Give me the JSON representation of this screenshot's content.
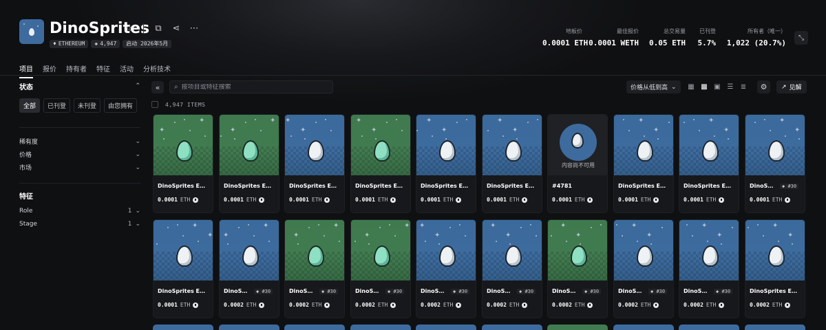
{
  "collection": {
    "title": "DinoSprites",
    "chain": "ETHEREUM",
    "supply": "4,947",
    "launched": "启动 2026年5月"
  },
  "stats": [
    {
      "label": "地板价",
      "value": "0.0001 ETH"
    },
    {
      "label": "最佳报价",
      "value": "0.0001 WETH"
    },
    {
      "label": "总交易量",
      "value": "0.05 ETH"
    },
    {
      "label": "已刊登",
      "value": "5.7%"
    },
    {
      "label": "所有者（唯一）",
      "value": "1,022 (20.7%)"
    }
  ],
  "tabs": [
    "项目",
    "报价",
    "持有者",
    "特征",
    "活动",
    "分析技术"
  ],
  "sidebar": {
    "status_title": "状态",
    "status_chips": [
      "全部",
      "已刊登",
      "未刊登",
      "由您拥有"
    ],
    "filters": [
      "稀有度",
      "价格",
      "市场"
    ],
    "traits_title": "特征",
    "traits": [
      {
        "name": "Role",
        "count": "1"
      },
      {
        "name": "Stage",
        "count": "1"
      }
    ]
  },
  "toolbar": {
    "search_placeholder": "按项目或特征搜索",
    "sort_label": "价格从低到高",
    "insight_label": "见解",
    "items_count": "4,947 ITEMS"
  },
  "colors": {
    "blue_bg": "#3d6b9e",
    "green_bg": "#417b50",
    "page_bg": "#0f1012"
  },
  "cards": [
    {
      "bg": "green",
      "name": "DinoSprites Egg ...",
      "rank": "",
      "price": "0.0001",
      "currency": "ETH",
      "unavailable": false
    },
    {
      "bg": "green",
      "name": "DinoSprites Egg ...",
      "rank": "",
      "price": "0.0001",
      "currency": "ETH",
      "unavailable": false
    },
    {
      "bg": "blue",
      "name": "DinoSprites Egg ...",
      "rank": "",
      "price": "0.0001",
      "currency": "ETH",
      "unavailable": false
    },
    {
      "bg": "green",
      "name": "DinoSprites Egg ...",
      "rank": "",
      "price": "0.0001",
      "currency": "ETH",
      "unavailable": false
    },
    {
      "bg": "blue",
      "name": "DinoSprites Egg ...",
      "rank": "",
      "price": "0.0001",
      "currency": "ETH",
      "unavailable": false
    },
    {
      "bg": "blue",
      "name": "DinoSprites Egg ...",
      "rank": "",
      "price": "0.0001",
      "currency": "ETH",
      "unavailable": false
    },
    {
      "bg": "blue",
      "name": "#4781",
      "rank": "",
      "price": "0.0001",
      "currency": "ETH",
      "unavailable": true,
      "unavailable_text": "内容尚不可用"
    },
    {
      "bg": "blue",
      "name": "DinoSprites Egg ...",
      "rank": "",
      "price": "0.0001",
      "currency": "ETH",
      "unavailable": false
    },
    {
      "bg": "blue",
      "name": "DinoSprites Egg ...",
      "rank": "",
      "price": "0.0001",
      "currency": "ETH",
      "unavailable": false
    },
    {
      "bg": "blue",
      "name": "DinoSpri...",
      "rank": "#30",
      "price": "0.0001",
      "currency": "ETH",
      "unavailable": false
    },
    {
      "bg": "blue",
      "name": "DinoSprites Egg ...",
      "rank": "",
      "price": "0.0001",
      "currency": "ETH",
      "unavailable": false
    },
    {
      "bg": "blue",
      "name": "DinoSpri...",
      "rank": "#30",
      "price": "0.0002",
      "currency": "ETH",
      "unavailable": false
    },
    {
      "bg": "green",
      "name": "DinoSpri...",
      "rank": "#30",
      "price": "0.0002",
      "currency": "ETH",
      "unavailable": false
    },
    {
      "bg": "green",
      "name": "DinoSpri...",
      "rank": "#30",
      "price": "0.0002",
      "currency": "ETH",
      "unavailable": false
    },
    {
      "bg": "blue",
      "name": "DinoSpri...",
      "rank": "#30",
      "price": "0.0002",
      "currency": "ETH",
      "unavailable": false
    },
    {
      "bg": "blue",
      "name": "DinoSpri...",
      "rank": "#30",
      "price": "0.0002",
      "currency": "ETH",
      "unavailable": false
    },
    {
      "bg": "green",
      "name": "DinoSpri...",
      "rank": "#30",
      "price": "0.0002",
      "currency": "ETH",
      "unavailable": false
    },
    {
      "bg": "blue",
      "name": "DinoSpri...",
      "rank": "#30",
      "price": "0.0002",
      "currency": "ETH",
      "unavailable": false
    },
    {
      "bg": "blue",
      "name": "DinoSpri...",
      "rank": "#30",
      "price": "0.0002",
      "currency": "ETH",
      "unavailable": false
    },
    {
      "bg": "blue",
      "name": "DinoSprites Egg ...",
      "rank": "",
      "price": "0.0002",
      "currency": "ETH",
      "unavailable": false
    }
  ],
  "peek_row": [
    "blue",
    "blue",
    "blue",
    "blue",
    "blue",
    "blue",
    "green",
    "blue",
    "blue",
    "blue"
  ]
}
